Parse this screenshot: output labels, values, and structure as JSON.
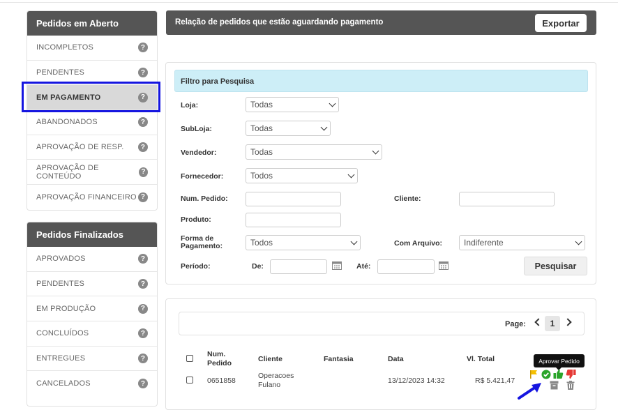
{
  "sidebar_open": {
    "title": "Pedidos em Aberto",
    "items": [
      {
        "label": "INCOMPLETOS"
      },
      {
        "label": "PENDENTES"
      },
      {
        "label": "EM PAGAMENTO"
      },
      {
        "label": "ABANDONADOS"
      },
      {
        "label": "APROVAÇÃO DE RESP."
      },
      {
        "label": "APROVAÇÃO DE CONTEÚDO"
      },
      {
        "label": "APROVAÇÃO FINANCEIRO"
      }
    ]
  },
  "sidebar_done": {
    "title": "Pedidos Finalizados",
    "items": [
      {
        "label": "APROVADOS"
      },
      {
        "label": "PENDENTES"
      },
      {
        "label": "EM PRODUÇÃO"
      },
      {
        "label": "CONCLUÍDOS"
      },
      {
        "label": "ENTREGUES"
      },
      {
        "label": "CANCELADOS"
      }
    ]
  },
  "help_glyph": "?",
  "header": {
    "title": "Relação de pedidos que estão aguardando pagamento",
    "export_label": "Exportar"
  },
  "filter": {
    "title": "Filtro para Pesquisa",
    "loja_label": "Loja:",
    "loja_value": "Todas",
    "subloja_label": "SubLoja:",
    "subloja_value": "Todas",
    "vendedor_label": "Vendedor:",
    "vendedor_value": "Todas",
    "fornecedor_label": "Fornecedor:",
    "fornecedor_value": "Todos",
    "num_pedido_label": "Num. Pedido:",
    "cliente_label": "Cliente:",
    "produto_label": "Produto:",
    "forma_pagamento_label": "Forma de Pagamento:",
    "forma_pagamento_value": "Todos",
    "com_arquivo_label": "Com Arquivo:",
    "com_arquivo_value": "Indiferente",
    "periodo_label": "Período:",
    "de_label": "De:",
    "ate_label": "Até:",
    "search_label": "Pesquisar"
  },
  "pager": {
    "label": "Page:",
    "current": "1"
  },
  "table": {
    "headers": {
      "num_pedido": "Num. Pedido",
      "cliente": "Cliente",
      "fantasia": "Fantasia",
      "data": "Data",
      "vl_total": "Vl. Total"
    },
    "rows": [
      {
        "num_pedido": "0651858",
        "cliente": "Operacoes Fulano",
        "fantasia": "",
        "data": "13/12/2023 14:32",
        "vl_total": "R$ 5.421,47"
      }
    ]
  },
  "tooltip": "Aprovar Pedido",
  "colors": {
    "accent_blue": "#1515e0",
    "header_bg": "#555555",
    "filter_title_bg": "#cdeef7",
    "approve_green": "#2aa52a",
    "reject_red": "#e53935",
    "flag_yellow": "#f5c000"
  }
}
